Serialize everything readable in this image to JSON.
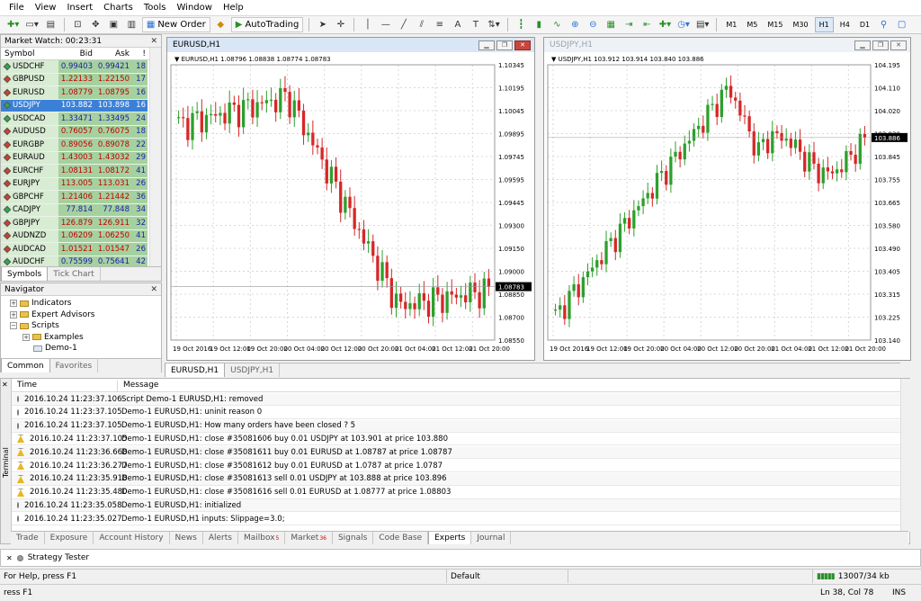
{
  "menu": [
    "File",
    "View",
    "Insert",
    "Charts",
    "Tools",
    "Window",
    "Help"
  ],
  "toolbar": {
    "new_order": "New Order",
    "auto_trading": "AutoTrading",
    "timeframes": [
      "M1",
      "M5",
      "M15",
      "M30",
      "H1",
      "H4",
      "D1"
    ],
    "active_timeframe": "H1"
  },
  "market_watch": {
    "title": "Market Watch: 00:23:31",
    "columns": {
      "symbol": "Symbol",
      "bid": "Bid",
      "ask": "Ask",
      "spread": "!"
    },
    "rows": [
      {
        "symbol": "USDCHF",
        "bid": "0.99403",
        "ask": "0.99421",
        "spread": "18",
        "dir": "up"
      },
      {
        "symbol": "GBPUSD",
        "bid": "1.22133",
        "ask": "1.22150",
        "spread": "17",
        "dir": "dn"
      },
      {
        "symbol": "EURUSD",
        "bid": "1.08779",
        "ask": "1.08795",
        "spread": "16",
        "dir": "dn"
      },
      {
        "symbol": "USDJPY",
        "bid": "103.882",
        "ask": "103.898",
        "spread": "16",
        "dir": "up",
        "selected": true
      },
      {
        "symbol": "USDCAD",
        "bid": "1.33471",
        "ask": "1.33495",
        "spread": "24",
        "dir": "up"
      },
      {
        "symbol": "AUDUSD",
        "bid": "0.76057",
        "ask": "0.76075",
        "spread": "18",
        "dir": "dn"
      },
      {
        "symbol": "EURGBP",
        "bid": "0.89056",
        "ask": "0.89078",
        "spread": "22",
        "dir": "dn"
      },
      {
        "symbol": "EURAUD",
        "bid": "1.43003",
        "ask": "1.43032",
        "spread": "29",
        "dir": "dn"
      },
      {
        "symbol": "EURCHF",
        "bid": "1.08131",
        "ask": "1.08172",
        "spread": "41",
        "dir": "dn"
      },
      {
        "symbol": "EURJPY",
        "bid": "113.005",
        "ask": "113.031",
        "spread": "26",
        "dir": "dn"
      },
      {
        "symbol": "GBPCHF",
        "bid": "1.21406",
        "ask": "1.21442",
        "spread": "36",
        "dir": "dn"
      },
      {
        "symbol": "CADJPY",
        "bid": "77.814",
        "ask": "77.848",
        "spread": "34",
        "dir": "up"
      },
      {
        "symbol": "GBPJPY",
        "bid": "126.879",
        "ask": "126.911",
        "spread": "32",
        "dir": "dn"
      },
      {
        "symbol": "AUDNZD",
        "bid": "1.06209",
        "ask": "1.06250",
        "spread": "41",
        "dir": "dn"
      },
      {
        "symbol": "AUDCAD",
        "bid": "1.01521",
        "ask": "1.01547",
        "spread": "26",
        "dir": "dn"
      },
      {
        "symbol": "AUDCHF",
        "bid": "0.75599",
        "ask": "0.75641",
        "spread": "42",
        "dir": "up"
      }
    ],
    "tabs": [
      "Symbols",
      "Tick Chart"
    ]
  },
  "navigator": {
    "title": "Navigator",
    "items": [
      "Indicators",
      "Expert Advisors",
      "Scripts",
      "Examples",
      "Demo-1"
    ],
    "tabs": [
      "Common",
      "Favorites"
    ]
  },
  "charts": [
    {
      "window_title": "EURUSD,H1",
      "info": "EURUSD,H1  1.08796 1.08838 1.08774 1.08783",
      "price_labels": [
        "1.10345",
        "1.10195",
        "1.10045",
        "1.09895",
        "1.09745",
        "1.09595",
        "1.09445",
        "1.09300",
        "1.09150",
        "1.09000",
        "1.08850",
        "1.08700",
        "1.08550"
      ],
      "current_price": "1.08783",
      "time_labels": [
        "19 Oct 2016",
        "19 Oct 12:00",
        "19 Oct 20:00",
        "20 Oct 04:00",
        "20 Oct 12:00",
        "20 Oct 20:00",
        "21 Oct 04:00",
        "21 Oct 12:00",
        "21 Oct 20:00"
      ]
    },
    {
      "window_title": "USDJPY,H1",
      "info": "USDJPY,H1  103.912 103.914 103.840 103.886",
      "price_labels": [
        "104.195",
        "104.110",
        "104.020",
        "103.930",
        "103.845",
        "103.755",
        "103.665",
        "103.580",
        "103.490",
        "103.405",
        "103.315",
        "103.225",
        "103.140"
      ],
      "current_price": "103.886",
      "time_labels": [
        "19 Oct 2016",
        "19 Oct 12:00",
        "19 Oct 20:00",
        "20 Oct 04:00",
        "20 Oct 12:00",
        "20 Oct 20:00",
        "21 Oct 04:00",
        "21 Oct 12:00",
        "21 Oct 20:00"
      ]
    }
  ],
  "chart_tabs": [
    "EURUSD,H1",
    "USDJPY,H1"
  ],
  "terminal": {
    "side_label": "Terminal",
    "columns": {
      "time": "Time",
      "message": "Message"
    },
    "rows": [
      {
        "time": "2016.10.24 11:23:37.106",
        "message": "Script Demo-1 EURUSD,H1: removed",
        "icon": "info"
      },
      {
        "time": "2016.10.24 11:23:37.105",
        "message": "Demo-1 EURUSD,H1: uninit reason 0",
        "icon": "info"
      },
      {
        "time": "2016.10.24 11:23:37.105",
        "message": "Demo-1 EURUSD,H1: How many orders have been closed ? 5",
        "icon": "info"
      },
      {
        "time": "2016.10.24 11:23:37.105",
        "message": "Demo-1 EURUSD,H1: close #35081606 buy 0.01 USDJPY at 103.901 at price 103.880",
        "icon": "warn"
      },
      {
        "time": "2016.10.24 11:23:36.668",
        "message": "Demo-1 EURUSD,H1: close #35081611 buy 0.01 EURUSD at 1.08787 at price 1.08787",
        "icon": "warn"
      },
      {
        "time": "2016.10.24 11:23:36.277",
        "message": "Demo-1 EURUSD,H1: close #35081612 buy 0.01 EURUSD at 1.0787 at price 1.0787",
        "icon": "warn"
      },
      {
        "time": "2016.10.24 11:23:35.918",
        "message": "Demo-1 EURUSD,H1: close #35081613 sell 0.01 USDJPY at 103.888 at price 103.896",
        "icon": "warn"
      },
      {
        "time": "2016.10.24 11:23:35.480",
        "message": "Demo-1 EURUSD,H1: close #35081616 sell 0.01 EURUSD at 1.08777 at price 1.08803",
        "icon": "warn"
      },
      {
        "time": "2016.10.24 11:23:35.058",
        "message": "Demo-1 EURUSD,H1: initialized",
        "icon": "info"
      },
      {
        "time": "2016.10.24 11:23:35.027",
        "message": "Demo-1 EURUSD,H1 inputs: Slippage=3.0;",
        "icon": "info"
      }
    ],
    "tabs": [
      {
        "label": "Trade"
      },
      {
        "label": "Exposure"
      },
      {
        "label": "Account History"
      },
      {
        "label": "News"
      },
      {
        "label": "Alerts"
      },
      {
        "label": "Mailbox",
        "badge": "5"
      },
      {
        "label": "Market",
        "badge": "36"
      },
      {
        "label": "Signals"
      },
      {
        "label": "Code Base"
      },
      {
        "label": "Experts",
        "active": true
      },
      {
        "label": "Journal"
      }
    ]
  },
  "strategy_tester": "Strategy Tester",
  "status": {
    "help": "For Help, press F1",
    "profile": "Default",
    "traffic": "13007/34 kb",
    "help2": "ress F1",
    "position": "Ln 38, Col 78",
    "mode": "INS"
  },
  "colors": {
    "bull": "#2ca02c",
    "bear": "#d62728",
    "selected_row": "#3b80d8",
    "mw_green": "#a5d19f"
  }
}
